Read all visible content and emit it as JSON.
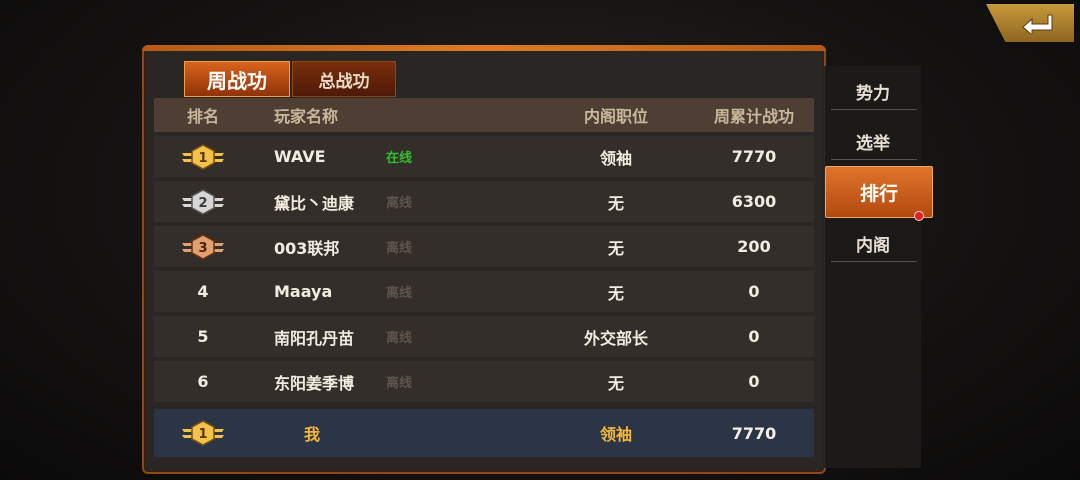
{
  "tabs": [
    {
      "label": "周战功",
      "active": true
    },
    {
      "label": "总战功",
      "active": false
    }
  ],
  "table": {
    "headers": [
      "排名",
      "玩家名称",
      "内阁职位",
      "周累计战功"
    ],
    "rows": [
      {
        "rank": "1",
        "badge": "gold",
        "name": "WAVE",
        "status": "在线",
        "online": true,
        "post": "领袖",
        "total": "7770"
      },
      {
        "rank": "2",
        "badge": "silver",
        "name": "黛比丶迪康",
        "status": "离线",
        "online": false,
        "post": "无",
        "total": "6300"
      },
      {
        "rank": "3",
        "badge": "bronze",
        "name": "003联邦",
        "status": "离线",
        "online": false,
        "post": "无",
        "total": "200"
      },
      {
        "rank": "4",
        "badge": "",
        "name": "Maaya",
        "status": "离线",
        "online": false,
        "post": "无",
        "total": "0"
      },
      {
        "rank": "5",
        "badge": "",
        "name": "南阳孔丹苗",
        "status": "离线",
        "online": false,
        "post": "外交部长",
        "total": "0"
      },
      {
        "rank": "6",
        "badge": "",
        "name": "东阳姜季博",
        "status": "离线",
        "online": false,
        "post": "无",
        "total": "0"
      }
    ],
    "self_row": {
      "rank": "1",
      "badge": "gold",
      "name": "我",
      "post": "领袖",
      "total": "7770"
    }
  },
  "side_menu": [
    {
      "label": "势力",
      "active": false
    },
    {
      "label": "选举",
      "active": false
    },
    {
      "label": "排行",
      "active": true
    },
    {
      "label": "内阁",
      "active": false
    }
  ],
  "colors": {
    "online": "#2fbf2f",
    "offline": "#5f544c",
    "accent": "#d8641c",
    "self_highlight": "#f4b73a"
  },
  "icons": {
    "back": "return-arrow-icon",
    "rank_badge": "winged-rank-badge-icon"
  }
}
